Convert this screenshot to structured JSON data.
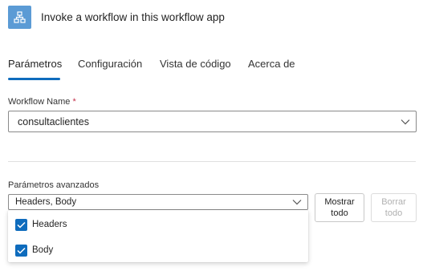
{
  "header": {
    "title": "Invoke a workflow in this workflow app",
    "icon": "workflow-hierarchy-icon"
  },
  "tabs": [
    {
      "label": "Parámetros",
      "active": true
    },
    {
      "label": "Configuración",
      "active": false
    },
    {
      "label": "Vista de código",
      "active": false
    },
    {
      "label": "Acerca de",
      "active": false
    }
  ],
  "workflow_name": {
    "label": "Workflow Name",
    "required_mark": "*",
    "value": "consultaclientes"
  },
  "advanced": {
    "label": "Parámetros avanzados",
    "value": "Headers, Body",
    "options": [
      {
        "label": "Headers",
        "checked": true
      },
      {
        "label": "Body",
        "checked": true
      }
    ],
    "show_all_label": "Mostrar todo",
    "clear_all_label": "Borrar todo"
  },
  "colors": {
    "accent": "#0f6cbd",
    "app_icon_bg": "#5b9bd5",
    "required": "#c4314b"
  }
}
